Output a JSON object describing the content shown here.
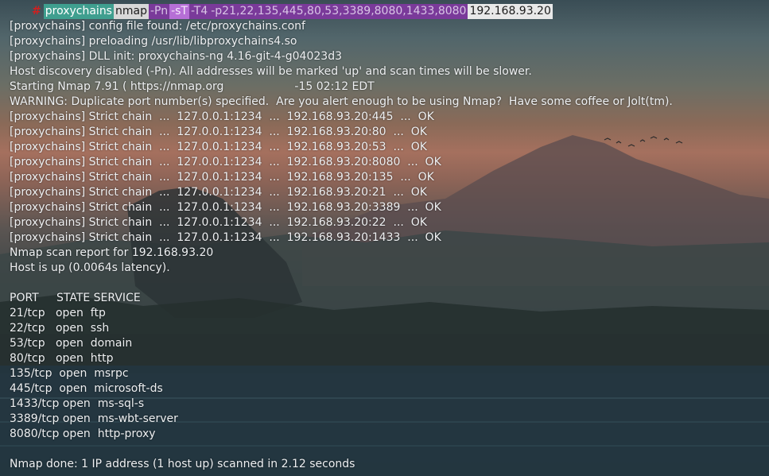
{
  "prompt": {
    "segments": [
      {
        "text": "proxychains",
        "style": "cmd"
      },
      {
        "text": "nmap",
        "style": "nmap"
      },
      {
        "text": "-Pn",
        "style": "opt"
      },
      {
        "text": "-sT",
        "style": "opt-hl"
      },
      {
        "text": "-T4",
        "style": "opt"
      },
      {
        "text": "-p21,22,135,445,80,53,3389,8080,1433,8080",
        "style": "opt"
      },
      {
        "text": "192.168.93.20",
        "style": "ip"
      }
    ]
  },
  "output_lines": [
    "[proxychains] config file found: /etc/proxychains.conf",
    "[proxychains] preloading /usr/lib/libproxychains4.so",
    "[proxychains] DLL init: proxychains-ng 4.16-git-4-g04023d3",
    "Host discovery disabled (-Pn). All addresses will be marked 'up' and scan times will be slower.",
    "Starting Nmap 7.91 ( https://nmap.org                    -15 02:12 EDT",
    "WARNING: Duplicate port number(s) specified.  Are you alert enough to be using Nmap?  Have some coffee or Jolt(tm).",
    "[proxychains] Strict chain  ...  127.0.0.1:1234  ...  192.168.93.20:445  ...  OK",
    "[proxychains] Strict chain  ...  127.0.0.1:1234  ...  192.168.93.20:80  ...  OK",
    "[proxychains] Strict chain  ...  127.0.0.1:1234  ...  192.168.93.20:53  ...  OK",
    "[proxychains] Strict chain  ...  127.0.0.1:1234  ...  192.168.93.20:8080  ...  OK",
    "[proxychains] Strict chain  ...  127.0.0.1:1234  ...  192.168.93.20:135  ...  OK",
    "[proxychains] Strict chain  ...  127.0.0.1:1234  ...  192.168.93.20:21  ...  OK",
    "[proxychains] Strict chain  ...  127.0.0.1:1234  ...  192.168.93.20:3389  ...  OK",
    "[proxychains] Strict chain  ...  127.0.0.1:1234  ...  192.168.93.20:22  ...  OK",
    "[proxychains] Strict chain  ...  127.0.0.1:1234  ...  192.168.93.20:1433  ...  OK",
    "Nmap scan report for 192.168.93.20",
    "Host is up (0.0064s latency).",
    "",
    "PORT     STATE SERVICE",
    "21/tcp   open  ftp",
    "22/tcp   open  ssh",
    "53/tcp   open  domain",
    "80/tcp   open  http",
    "135/tcp  open  msrpc",
    "445/tcp  open  microsoft-ds",
    "1433/tcp open  ms-sql-s",
    "3389/tcp open  ms-wbt-server",
    "8080/tcp open  http-proxy",
    "",
    "Nmap done: 1 IP address (1 host up) scanned in 2.12 seconds"
  ]
}
